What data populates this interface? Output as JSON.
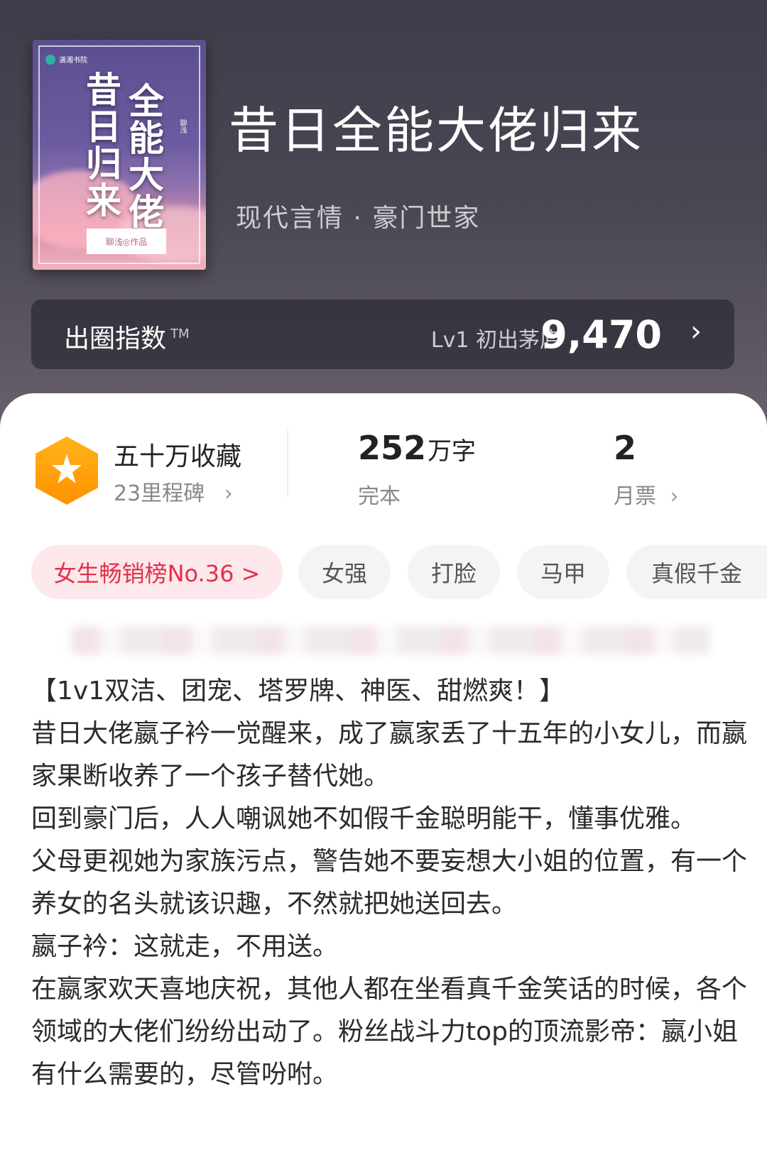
{
  "cover": {
    "publisher": "潇湘书院",
    "title_left": "昔日归来",
    "title_right": "全能大佬",
    "author": "聊浅",
    "label": "聊浅◎作品"
  },
  "book": {
    "title": "昔日全能大佬归来",
    "genre": "现代言情 · 豪门世家"
  },
  "index": {
    "label": "出圈指数",
    "tm": "TM",
    "level": "Lv1 初出茅庐",
    "value": "9,470",
    "arrow": "›"
  },
  "stats": {
    "favorites_title": "五十万收藏",
    "favorites_sub": "23里程碑",
    "word_count": "252",
    "word_unit": "万字",
    "status": "完本",
    "monthly_votes": "2",
    "monthly_label": "月票",
    "chevron": "›"
  },
  "tags": {
    "rank": "女生畅销榜No.36 >",
    "items": [
      "女强",
      "打脸",
      "马甲",
      "真假千金"
    ]
  },
  "synopsis": [
    "【1v1双洁、团宠、塔罗牌、神医、甜燃爽！】",
    "昔日大佬嬴子衿一觉醒来，成了嬴家丢了十五年的小女儿，而嬴家果断收养了一个孩子替代她。",
    "回到豪门后，人人嘲讽她不如假千金聪明能干，懂事优雅。",
    "父母更视她为家族污点，警告她不要妄想大小姐的位置，有一个养女的名头就该识趣，不然就把她送回去。",
    "嬴子衿：这就走，不用送。",
    "在嬴家欢天喜地庆祝，其他人都在坐看真千金笑话的时候，各个领域的大佬们纷纷出动了。粉丝战斗力top的顶流影帝：嬴小姐有什么需要的，尽管吩咐。"
  ],
  "colors": {
    "accent_red": "#e3304b",
    "star_orange": "#ff9f0a"
  }
}
